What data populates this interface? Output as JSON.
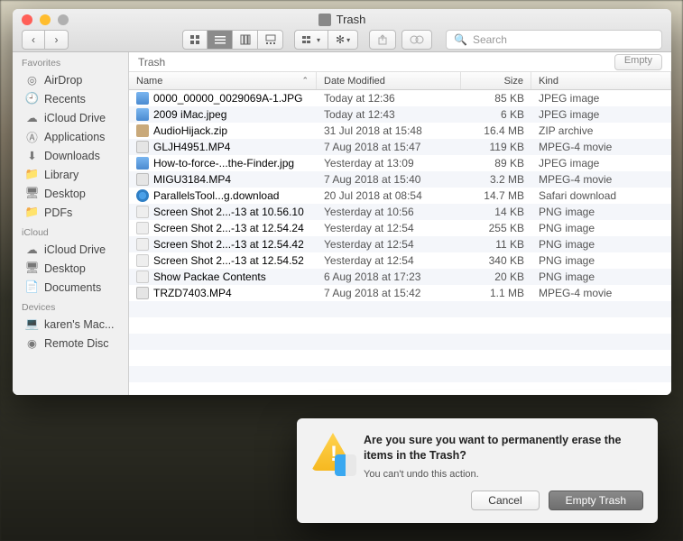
{
  "window": {
    "title": "Trash",
    "path_label": "Trash",
    "empty_button": "Empty",
    "search_placeholder": "Search"
  },
  "sidebar": {
    "sections": [
      {
        "title": "Favorites",
        "items": [
          {
            "label": "AirDrop",
            "icon": "airdrop-icon"
          },
          {
            "label": "Recents",
            "icon": "recents-icon"
          },
          {
            "label": "iCloud Drive",
            "icon": "cloud-icon"
          },
          {
            "label": "Applications",
            "icon": "applications-icon"
          },
          {
            "label": "Downloads",
            "icon": "downloads-icon"
          },
          {
            "label": "Library",
            "icon": "folder-icon"
          },
          {
            "label": "Desktop",
            "icon": "desktop-icon"
          },
          {
            "label": "PDFs",
            "icon": "folder-icon"
          }
        ]
      },
      {
        "title": "iCloud",
        "items": [
          {
            "label": "iCloud Drive",
            "icon": "cloud-icon"
          },
          {
            "label": "Desktop",
            "icon": "desktop-icon"
          },
          {
            "label": "Documents",
            "icon": "documents-icon"
          }
        ]
      },
      {
        "title": "Devices",
        "items": [
          {
            "label": "karen's Mac...",
            "icon": "computer-icon"
          },
          {
            "label": "Remote Disc",
            "icon": "disc-icon"
          }
        ]
      }
    ]
  },
  "columns": {
    "name": "Name",
    "date": "Date Modified",
    "size": "Size",
    "kind": "Kind"
  },
  "files": [
    {
      "name": "0000_00000_0029069A-1.JPG",
      "date": "Today at 12:36",
      "size": "85 KB",
      "kind": "JPEG image",
      "ft": "img"
    },
    {
      "name": "2009 iMac.jpeg",
      "date": "Today at 12:43",
      "size": "6 KB",
      "kind": "JPEG image",
      "ft": "img"
    },
    {
      "name": "AudioHijack.zip",
      "date": "31 Jul 2018 at 15:48",
      "size": "16.4 MB",
      "kind": "ZIP archive",
      "ft": "zip"
    },
    {
      "name": "GLJH4951.MP4",
      "date": "7 Aug 2018 at 15:47",
      "size": "119 KB",
      "kind": "MPEG-4 movie",
      "ft": "mov"
    },
    {
      "name": "How-to-force-...the-Finder.jpg",
      "date": "Yesterday at 13:09",
      "size": "89 KB",
      "kind": "JPEG image",
      "ft": "img"
    },
    {
      "name": "MIGU3184.MP4",
      "date": "7 Aug 2018 at 15:40",
      "size": "3.2 MB",
      "kind": "MPEG-4 movie",
      "ft": "mov"
    },
    {
      "name": "ParallelsTool...g.download",
      "date": "20 Jul 2018 at 08:54",
      "size": "14.7 MB",
      "kind": "Safari download",
      "ft": "dl"
    },
    {
      "name": "Screen Shot 2...-13 at 10.56.10",
      "date": "Yesterday at 10:56",
      "size": "14 KB",
      "kind": "PNG image",
      "ft": "png"
    },
    {
      "name": "Screen Shot 2...-13 at 12.54.24",
      "date": "Yesterday at 12:54",
      "size": "255 KB",
      "kind": "PNG image",
      "ft": "png"
    },
    {
      "name": "Screen Shot 2...-13 at 12.54.42",
      "date": "Yesterday at 12:54",
      "size": "11 KB",
      "kind": "PNG image",
      "ft": "png"
    },
    {
      "name": "Screen Shot 2...-13 at 12.54.52",
      "date": "Yesterday at 12:54",
      "size": "340 KB",
      "kind": "PNG image",
      "ft": "png"
    },
    {
      "name": "Show Packae Contents",
      "date": "6 Aug 2018 at 17:23",
      "size": "20 KB",
      "kind": "PNG image",
      "ft": "png"
    },
    {
      "name": "TRZD7403.MP4",
      "date": "7 Aug 2018 at 15:42",
      "size": "1.1 MB",
      "kind": "MPEG-4 movie",
      "ft": "mov"
    }
  ],
  "dialog": {
    "title": "Are you sure you want to permanently erase the items in the Trash?",
    "subtitle": "You can't undo this action.",
    "cancel": "Cancel",
    "confirm": "Empty Trash"
  }
}
